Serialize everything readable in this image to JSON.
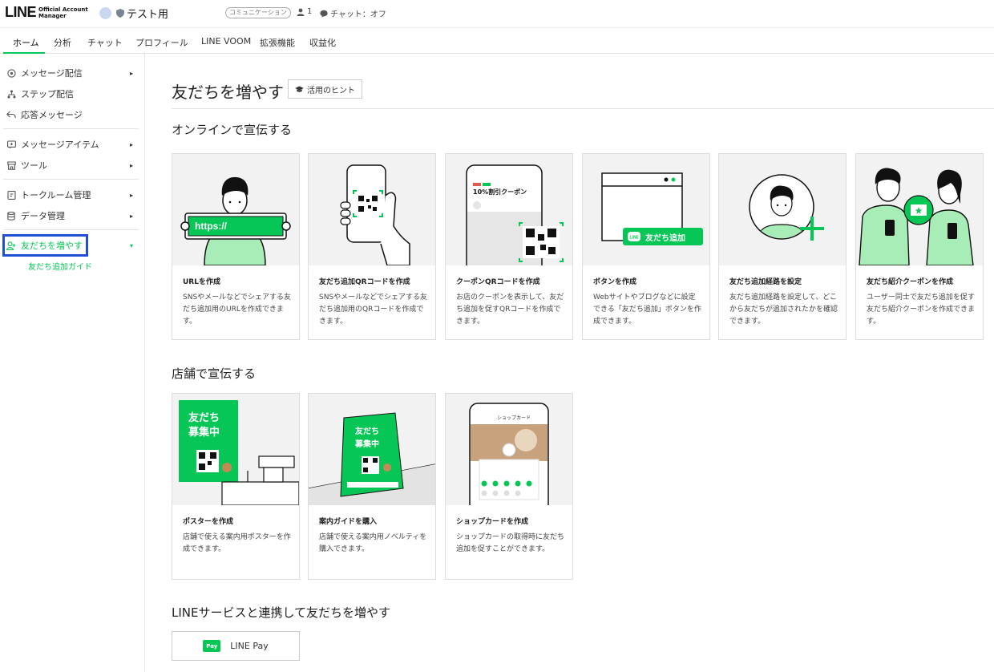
{
  "header": {
    "logo": "LINE",
    "logo_sub_1": "Official Account",
    "logo_sub_2": "Manager",
    "account_name": "テスト用",
    "plan_tag": "コミュニケーション",
    "friend_count": "1",
    "chat_status": "チャット：オフ"
  },
  "tabs": [
    "ホーム",
    "分析",
    "チャット",
    "プロフィール",
    "LINE VOOM",
    "拡張機能",
    "収益化"
  ],
  "sidebar": {
    "items": [
      {
        "label": "メッセージ配信",
        "icon": "broadcast-icon",
        "arrow": "▸"
      },
      {
        "label": "ステップ配信",
        "icon": "step-icon"
      },
      {
        "label": "応答メッセージ",
        "icon": "reply-icon"
      },
      {
        "label": "メッセージアイテム",
        "icon": "message-item-icon",
        "arrow": "▸"
      },
      {
        "label": "ツール",
        "icon": "shop-icon",
        "arrow": "▸"
      },
      {
        "label": "トークルーム管理",
        "icon": "talkroom-icon",
        "arrow": "▸"
      },
      {
        "label": "データ管理",
        "icon": "database-icon",
        "arrow": "▸"
      },
      {
        "label": "友だちを増やす",
        "icon": "add-friend-icon",
        "arrow": "▾"
      }
    ],
    "sub_item": "友だち追加ガイド"
  },
  "main": {
    "title": "友だちを増やす",
    "hint_button": "活用のヒント",
    "online_section": "オンラインで宣伝する",
    "store_section": "店舗で宣伝する",
    "line_service_section": "LINEサービスと連携して友だちを増やす",
    "online_cards": [
      {
        "title": "URLを作成",
        "desc": "SNSやメールなどでシェアする友だち追加用のURLを作成できます。",
        "image_text": "https://"
      },
      {
        "title": "友だち追加QRコードを作成",
        "desc": "SNSやメールなどでシェアする友だち追加用のQRコードを作成できます。"
      },
      {
        "title": "クーポンQRコードを作成",
        "desc": "お店のクーポンを表示して、友だち追加を促すQRコードを作成できます。",
        "image_text": "10%割引クーポン"
      },
      {
        "title": "ボタンを作成",
        "desc": "Webサイトやブログなどに設定できる「友だち追加」ボタンを作成できます。",
        "image_text": "友だち追加",
        "image_badge": "LINE"
      },
      {
        "title": "友だち追加経路を設定",
        "desc": "友だち追加経路を設定して、どこから友だちが追加されたかを確認できます。"
      },
      {
        "title": "友だち紹介クーポンを作成",
        "desc": "ユーザー同士で友だち追加を促す友だち紹介クーポンを作成できます。"
      }
    ],
    "store_cards": [
      {
        "title": "ポスターを作成",
        "desc": "店舗で使える案内用ポスターを作成できます。",
        "image_text_1": "友だち",
        "image_text_2": "募集中"
      },
      {
        "title": "案内ガイドを購入",
        "desc": "店舗で使える案内用ノベルティを購入できます。",
        "image_text_1": "友だち",
        "image_text_2": "募集中"
      },
      {
        "title": "ショップカードを作成",
        "desc": "ショップカードの取得時に友だち追加を促すことができます。",
        "image_text": "ショップカード"
      }
    ],
    "line_pay": {
      "badge": "Pay",
      "label": "LINE Pay"
    }
  },
  "colors": {
    "brand": "#06c755",
    "active_outline": "#1f4fd6",
    "card_bg": "#f2f2f2"
  }
}
